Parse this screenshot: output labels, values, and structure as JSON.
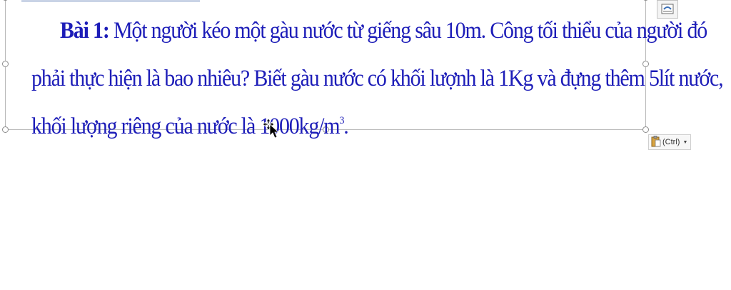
{
  "problem": {
    "label": "Bài 1:",
    "line1": " Một người kéo một gàu nước từ giếng sâu 10m. Công tối thiểu của người đó",
    "line2": "phải thực hiện là bao nhiêu? Biết gàu nước có khối lượnh là 1Kg và đựng thêm 5lít nước,",
    "line3": "khối lượng riêng của nước là 1000kg/m",
    "exponent": "3",
    "ending": "."
  },
  "paste_options": {
    "label": "(Ctrl)",
    "icon": "clipboard-icon"
  },
  "layout_options": {
    "icon": "layout-options-icon"
  },
  "colors": {
    "text": "#1d1db8",
    "frame": "#b9b9b9"
  }
}
